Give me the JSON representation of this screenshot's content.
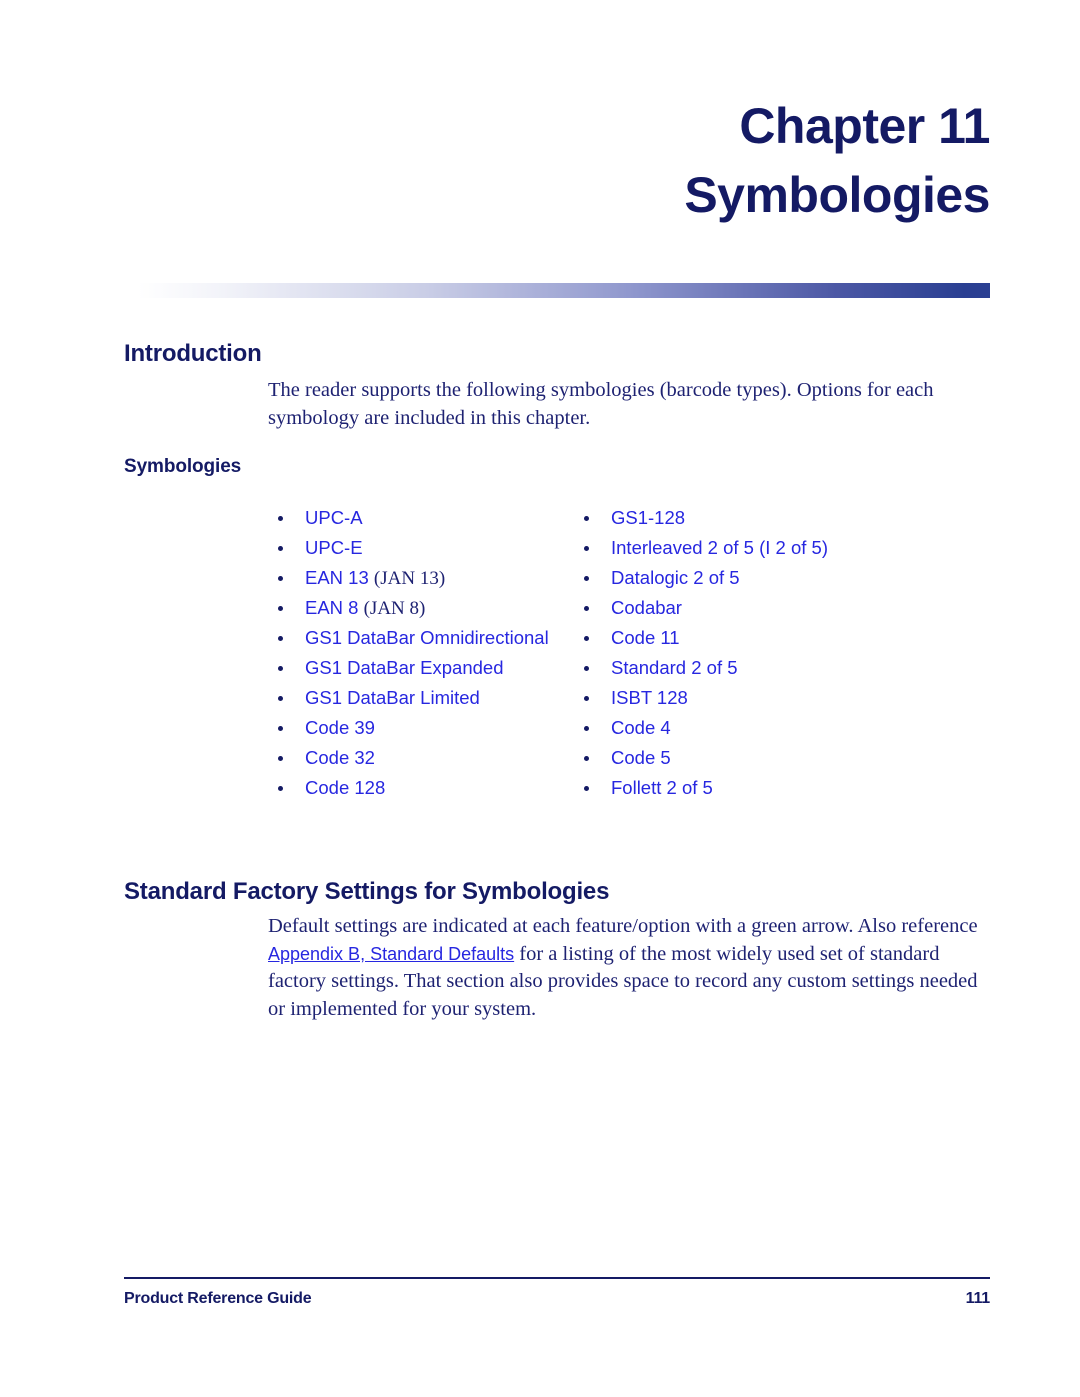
{
  "document": {
    "chapter_number": "Chapter 11",
    "chapter_title": "Symbologies",
    "colors": {
      "heading_navy": "#141A64",
      "body_navy": "#1E2272",
      "link_blue": "#2727E0",
      "rule_blue": "#2A3F92"
    }
  },
  "introduction": {
    "heading": "Introduction",
    "paragraph": "The reader supports the following symbologies (barcode types). Options for each symbology are included in this chapter."
  },
  "symbologies_section": {
    "heading": "Symbologies",
    "left_column": [
      {
        "label": "UPC-A",
        "alt": ""
      },
      {
        "label": "UPC-E",
        "alt": ""
      },
      {
        "label": "EAN 13",
        "alt": "(JAN 13)"
      },
      {
        "label": "EAN 8",
        "alt": "(JAN 8)"
      },
      {
        "label": "GS1 DataBar Omnidirectional",
        "alt": ""
      },
      {
        "label": "GS1 DataBar Expanded",
        "alt": ""
      },
      {
        "label": "GS1 DataBar Limited",
        "alt": ""
      },
      {
        "label": "Code 39",
        "alt": ""
      },
      {
        "label": "Code 32",
        "alt": ""
      },
      {
        "label": "Code 128",
        "alt": ""
      }
    ],
    "right_column": [
      {
        "label": "GS1-128",
        "alt": ""
      },
      {
        "label": "Interleaved 2 of 5 (I 2 of 5)",
        "alt": ""
      },
      {
        "label": "Datalogic 2 of 5",
        "alt": ""
      },
      {
        "label": "Codabar",
        "alt": ""
      },
      {
        "label": "Code 11",
        "alt": ""
      },
      {
        "label": "Standard 2 of 5",
        "alt": ""
      },
      {
        "label": "ISBT 128",
        "alt": ""
      },
      {
        "label": "Code 4",
        "alt": ""
      },
      {
        "label": "Code 5",
        "alt": ""
      },
      {
        "label": "Follett 2 of 5",
        "alt": ""
      }
    ]
  },
  "factory_settings_section": {
    "heading": "Standard Factory Settings for Symbologies",
    "paragraph_part1": "Default settings are indicated at each feature/option with a green arrow. Also reference ",
    "link_text": "Appendix B, Standard Defaults",
    "paragraph_part2": " for a listing of the most widely used set of standard factory settings. That section also provides space to record any custom settings needed or implemented for your system."
  },
  "footer": {
    "title": "Product Reference Guide",
    "page_number": "111"
  }
}
